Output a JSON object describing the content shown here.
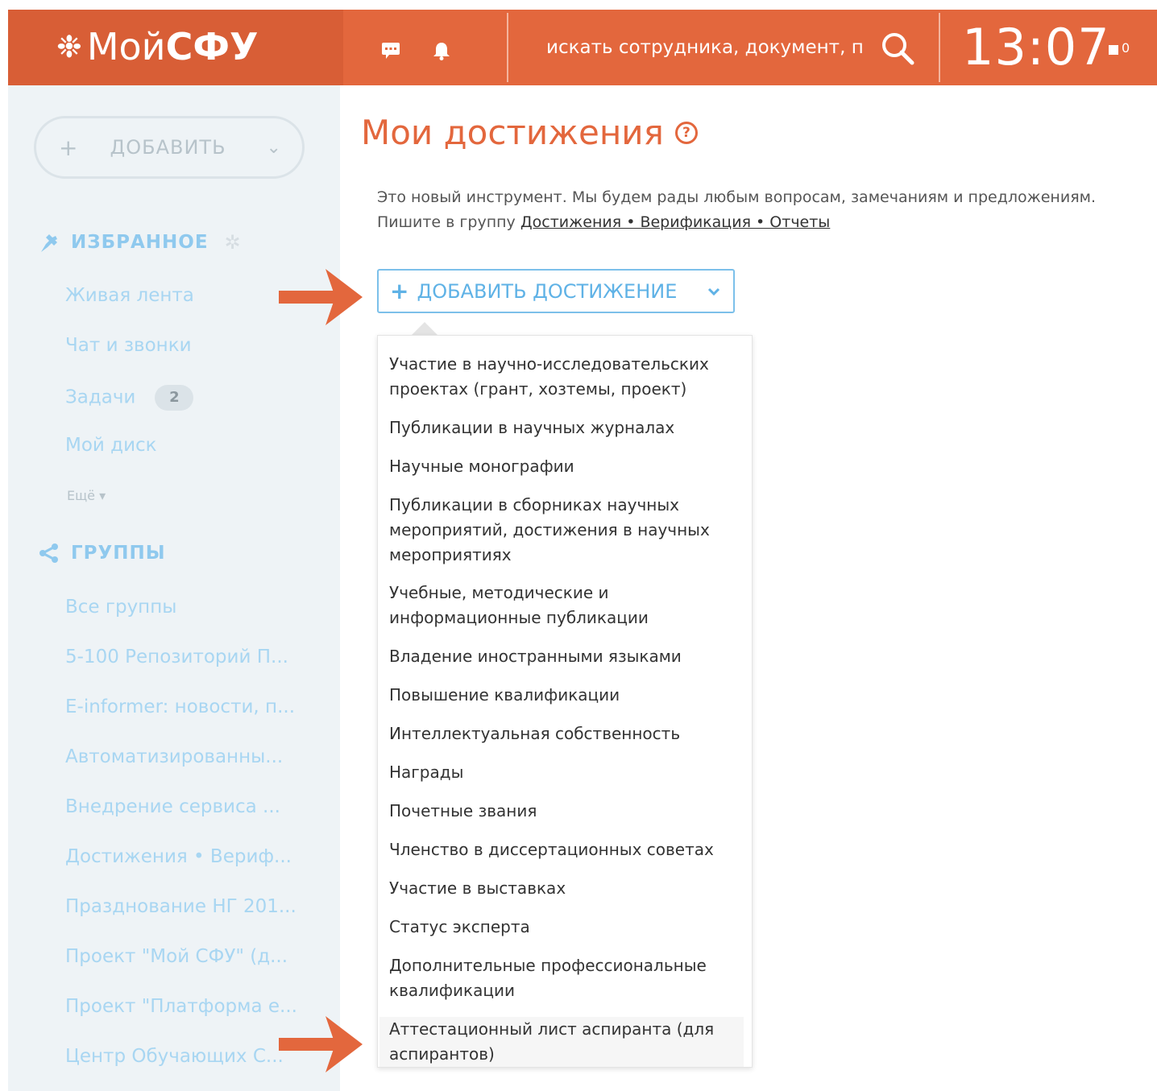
{
  "header": {
    "logo_prefix": "Мой",
    "logo_bold": "СФУ",
    "search_placeholder": "искать сотрудника, документ, прс",
    "clock": "13:07",
    "flag_count": "0",
    "colors": {
      "header_bg": "#e3673d",
      "accent_blue": "#5fb2e6"
    }
  },
  "sidebar": {
    "add_label": "ДОБАВИТЬ",
    "favorites_title": "ИЗБРАННОЕ",
    "favorites": [
      {
        "label": "Живая лента"
      },
      {
        "label": "Чат и звонки"
      },
      {
        "label": "Задачи",
        "badge": "2"
      },
      {
        "label": "Мой диск"
      }
    ],
    "more_label": "Ещё",
    "groups_title": "ГРУППЫ",
    "groups": [
      "Все группы",
      "5-100 Репозиторий П...",
      "E-informer: новости, п...",
      "Автоматизированны...",
      "Внедрение сервиса ...",
      "Достижения • Вериф...",
      "Празднование НГ 201...",
      "Проект \"Мой СФУ\" (д...",
      "Проект \"Платформа е...",
      "Центр Обучающих С..."
    ]
  },
  "main": {
    "title": "Мои достижения",
    "intro_line1": "Это новый инструмент. Мы будем рады любым вопросам, замечаниям и предложениям.",
    "intro_line2_prefix": "Пишите в группу ",
    "intro_link": "Достижения • Верификация • Отчеты",
    "add_achievement_label": "ДОБАВИТЬ ДОСТИЖЕНИЕ",
    "menu": [
      [
        "Участие в научно-исследовательских",
        "проектах (грант, хозтемы, проект)"
      ],
      [
        "Публикации в научных журналах"
      ],
      [
        "Научные монографии"
      ],
      [
        "Публикации в сборниках научных",
        "мероприятий, достижения в научных",
        "мероприятиях"
      ],
      [
        "Учебные, методические и",
        "информационные публикации"
      ],
      [
        "Владение иностранными языками"
      ],
      [
        "Повышение квалификации"
      ],
      [
        "Интеллектуальная собственность"
      ],
      [
        "Награды"
      ],
      [
        "Почетные звания"
      ],
      [
        "Членство в диссертационных советах"
      ],
      [
        "Участие в выставках"
      ],
      [
        "Статус эксперта"
      ],
      [
        "Дополнительные профессиональные",
        "квалификации"
      ],
      [
        "Аттестационный лист аспиранта (для",
        "аспирантов)"
      ]
    ]
  }
}
